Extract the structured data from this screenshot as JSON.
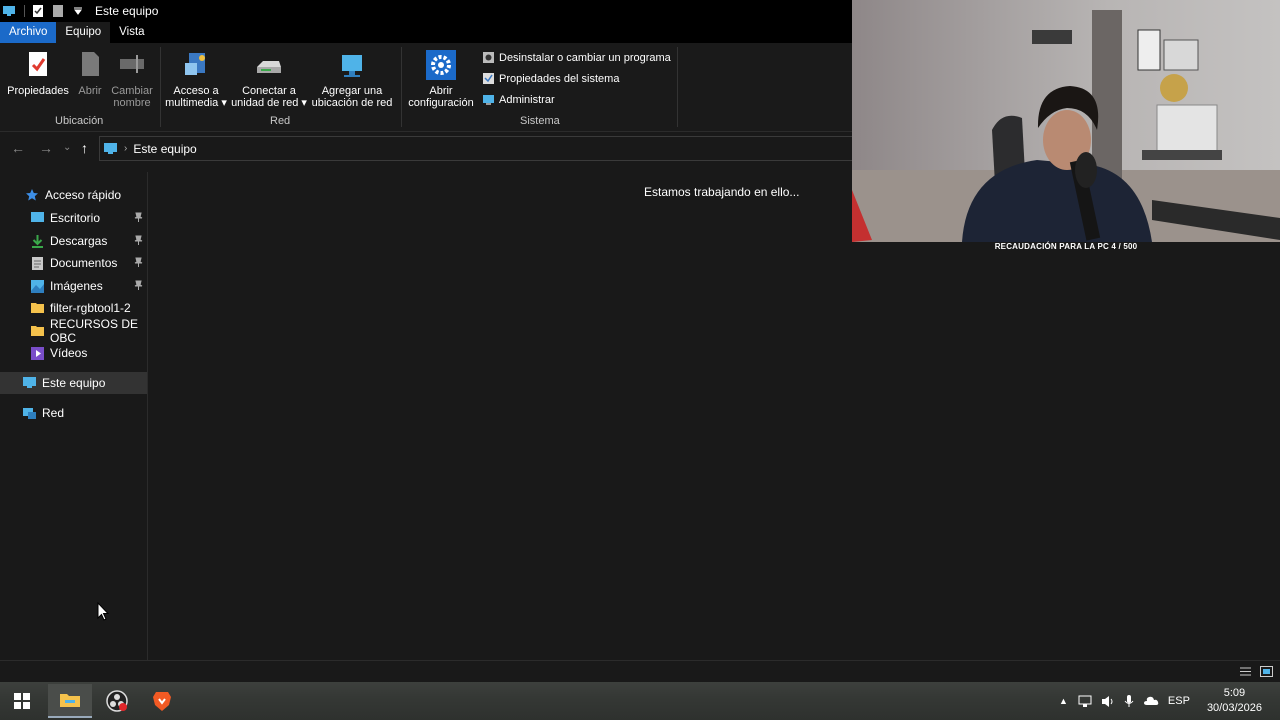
{
  "window": {
    "title": "Este equipo"
  },
  "tabs": [
    {
      "label": "Archivo"
    },
    {
      "label": "Equipo"
    },
    {
      "label": "Vista"
    }
  ],
  "ribbon": {
    "ubicacion": {
      "group_label": "Ubicación",
      "propiedades": "Propiedades",
      "abrir": "Abrir",
      "cambiar_nombre_1": "Cambiar",
      "cambiar_nombre_2": "nombre"
    },
    "red": {
      "group_label": "Red",
      "acceso_1": "Acceso a",
      "acceso_2": "multimedia",
      "conectar_1": "Conectar a",
      "conectar_2": "unidad de red",
      "agregar_1": "Agregar una",
      "agregar_2": "ubicación de red"
    },
    "sistema": {
      "group_label": "Sistema",
      "abrir_1": "Abrir",
      "abrir_2": "configuración",
      "desinstalar": "Desinstalar o cambiar un programa",
      "propiedades_sistema": "Propiedades del sistema",
      "administrar": "Administrar"
    }
  },
  "address": {
    "path": "Este equipo"
  },
  "sidebar": {
    "quick_access": "Acceso rápido",
    "items": [
      {
        "label": "Escritorio",
        "pinned": true
      },
      {
        "label": "Descargas",
        "pinned": true
      },
      {
        "label": "Documentos",
        "pinned": true
      },
      {
        "label": "Imágenes",
        "pinned": true
      },
      {
        "label": "filter-rgbtool1-2",
        "pinned": false
      },
      {
        "label": "RECURSOS DE OBC",
        "pinned": false
      },
      {
        "label": "Vídeos",
        "pinned": false
      }
    ],
    "this_pc": "Este equipo",
    "network": "Red"
  },
  "content": {
    "status_message": "Estamos trabajando en ello..."
  },
  "webcam": {
    "caption": "RECAUDACIÓN PARA LA PC 4 / 500"
  },
  "taskbar": {
    "language": "ESP",
    "time": "5:09",
    "date": "30/03/2026"
  },
  "colors": {
    "accent": "#1b6ac9",
    "background": "#191919",
    "ribbon": "#1a1a1a",
    "selected": "#333333"
  }
}
